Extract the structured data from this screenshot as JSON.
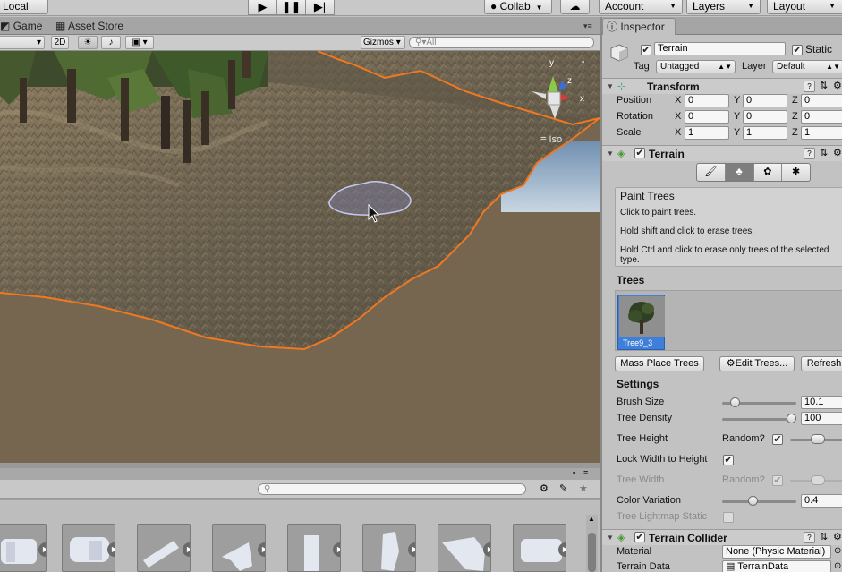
{
  "toolbar": {
    "local": "Local",
    "collab": "Collab",
    "account": "Account",
    "layers": "Layers",
    "layout": "Layout"
  },
  "tabs": {
    "game": "Game",
    "asset_store": "Asset Store",
    "inspector": "Inspector"
  },
  "scene_bar": {
    "mode_2d": "2D",
    "gizmos": "Gizmos",
    "search_placeholder": "All",
    "iso_label": "Iso",
    "axis_y": "y",
    "axis_z": "z",
    "axis_x": "x"
  },
  "inspector": {
    "object_name": "Terrain",
    "static_label": "Static",
    "tag_label": "Tag",
    "tag_value": "Untagged",
    "layer_label": "Layer",
    "layer_value": "Default",
    "transform": {
      "title": "Transform",
      "rows": [
        {
          "label": "Position",
          "x": "0",
          "y": "0",
          "z": "0"
        },
        {
          "label": "Rotation",
          "x": "0",
          "y": "0",
          "z": "0"
        },
        {
          "label": "Scale",
          "x": "1",
          "y": "1",
          "z": "1"
        }
      ],
      "x_label": "X",
      "y_label": "Y",
      "z_label": "Z"
    },
    "terrain": {
      "title": "Terrain",
      "help_title": "Paint Trees",
      "help_lines": [
        "Click to paint trees.",
        "Hold shift and click to erase trees.",
        "Hold Ctrl and click to erase only trees of the selected type."
      ],
      "trees_header": "Trees",
      "tree_name": "Tree9_3",
      "mass_place": "Mass Place Trees",
      "edit_trees": "Edit Trees...",
      "refresh": "Refresh",
      "settings_header": "Settings",
      "brush_size_label": "Brush Size",
      "brush_size_value": "10.1",
      "brush_size_level": 0.12,
      "tree_density_label": "Tree Density",
      "tree_density_value": "100",
      "tree_density_level": 1.0,
      "tree_height_label": "Tree Height",
      "random_label": "Random?",
      "lock_label": "Lock Width to Height",
      "tree_width_label": "Tree Width",
      "color_variation_label": "Color Variation",
      "color_variation_value": "0.4",
      "color_variation_level": 0.4,
      "lightmap_label": "Tree Lightmap Static"
    },
    "collider": {
      "title": "Terrain Collider",
      "material_label": "Material",
      "material_value": "None (Physic Material)",
      "data_label": "Terrain Data",
      "data_value": "TerrainData"
    }
  },
  "colors": {
    "selection_outline": "#f07820",
    "terrain": "#6e6452",
    "sky": "#a8c4dc",
    "ground": "#77664f"
  }
}
